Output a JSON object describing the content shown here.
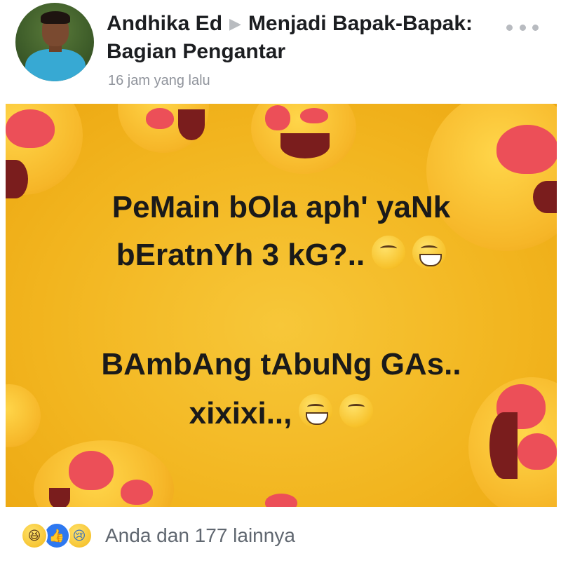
{
  "post": {
    "author": "Andhika Ed",
    "arrow_icon": "triangle-right-icon",
    "group": "Menjadi Bapak-Bapak: Bagian Pengantar",
    "timestamp": "16 jam yang lalu",
    "more_icon": "more-dots-icon"
  },
  "image": {
    "line1": "PeMain bOla aph' yaNk",
    "line2": "bEratnYh 3 kG?..",
    "line3": "BAmbAng tAbuNg GAs..",
    "line4": "xixixi..,",
    "background_color": "#f2b51f"
  },
  "reactions": {
    "icons": [
      "haha-reaction-icon",
      "like-reaction-icon",
      "sad-reaction-icon"
    ],
    "summary": "Anda dan 177 lainnya"
  }
}
